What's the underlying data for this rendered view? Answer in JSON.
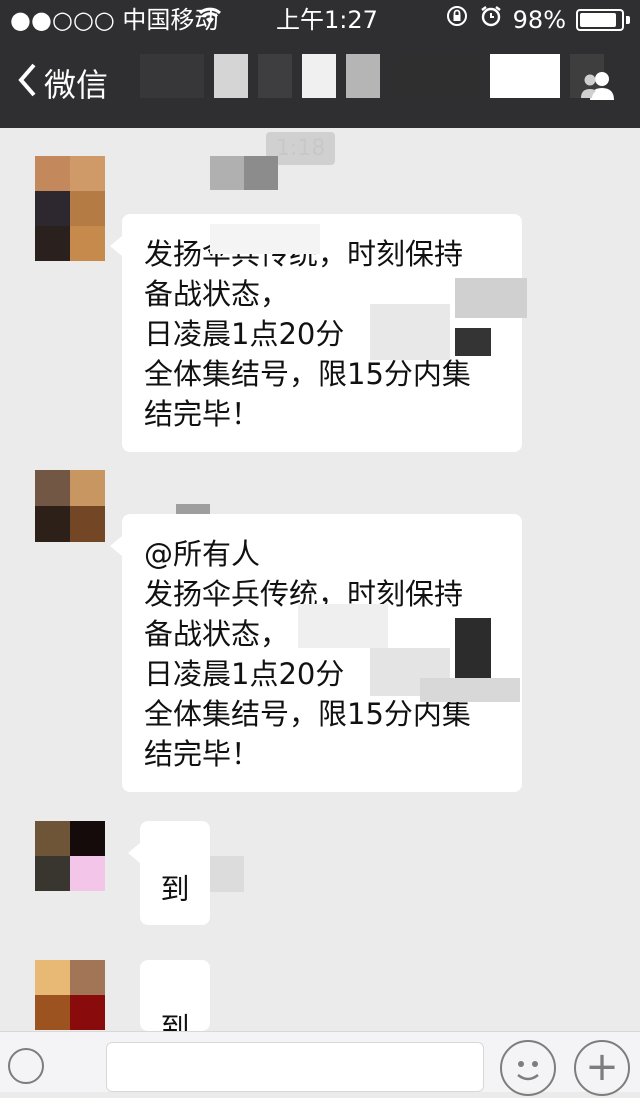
{
  "status_bar": {
    "carrier": "●●○○○ 中国移动",
    "time": "上午1:27",
    "battery": "98%"
  },
  "nav": {
    "back_label": "微信"
  },
  "chat": {
    "timestamp": "1:18",
    "messages": [
      {
        "lines": [
          "发扬伞兵传统，时刻保持",
          "备战状态，",
          "日凌晨1点20分",
          "全体集结号，限15分内集",
          "结完毕！"
        ]
      },
      {
        "lines": [
          "@所有人",
          "发扬伞兵传统，时刻保持",
          "备战状态，",
          "日凌晨1点20分",
          "全体集结号，限15分内集",
          "结完毕！"
        ]
      },
      {
        "lines": [
          "到"
        ]
      },
      {
        "lines": [
          "到"
        ]
      }
    ]
  },
  "icons": {
    "back": "chevron-left-icon",
    "contact": "user-group-icon",
    "wifi": "wifi-icon",
    "lock": "rotation-lock-icon",
    "alarm": "alarm-icon",
    "voice": "voice-icon",
    "emoji": "emoji-icon",
    "plus": "plus-icon"
  }
}
